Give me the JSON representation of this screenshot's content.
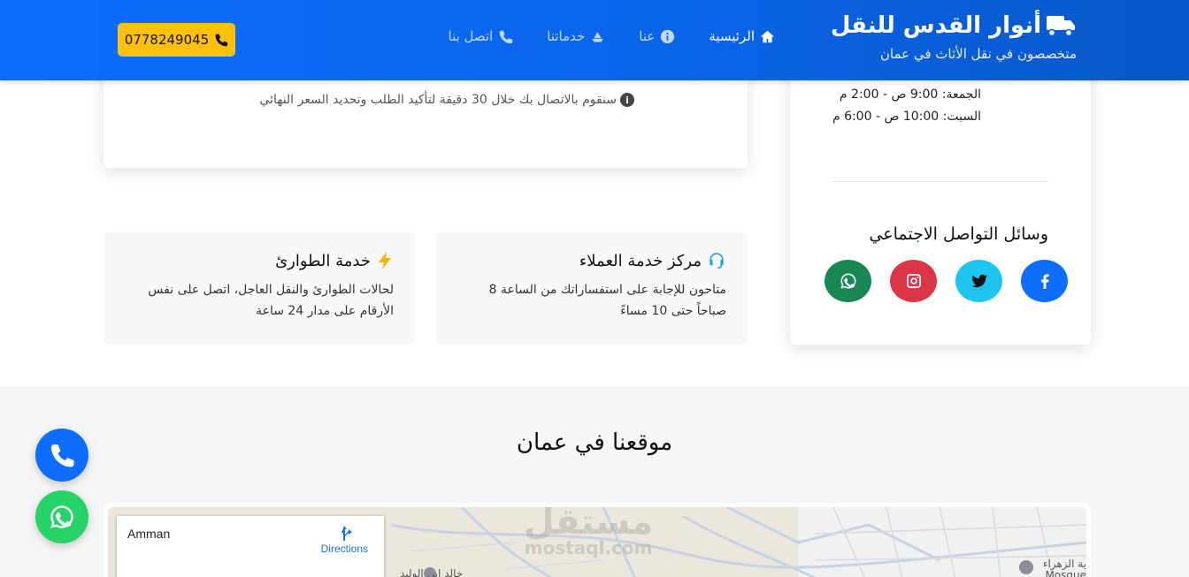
{
  "header": {
    "brand_title": "أنوار القدس للنقل",
    "brand_subtitle": "متخصصون في نقل الأثاث في عمان",
    "nav": [
      {
        "label": "الرئيسية",
        "icon": "home-icon",
        "active": true
      },
      {
        "label": "عنا",
        "icon": "info-icon",
        "active": false
      },
      {
        "label": "خدماتنا",
        "icon": "services-icon",
        "active": false
      },
      {
        "label": "اتصل بنا",
        "icon": "phone-icon",
        "active": false
      }
    ],
    "phone_button": "0778249045",
    "colors": {
      "primary": "#0d6efd",
      "accent": "#ffc107"
    }
  },
  "form_card": {
    "note": "سنقوم بالاتصال بك خلال 30 دقيقة لتأكيد الطلب وتحديد السعر النهائي"
  },
  "sidebar": {
    "hours_friday": "الجمعة: 9:00 ص - 2:00 م",
    "hours_saturday": "السبت: 10:00 ص - 6:00 م",
    "social_title": "وسائل التواصل الاجتماعي",
    "socials": [
      {
        "name": "facebook",
        "color": "#1877f2"
      },
      {
        "name": "twitter",
        "color": "#1da1f2"
      },
      {
        "name": "instagram",
        "color": "#dc3545"
      },
      {
        "name": "whatsapp",
        "color": "#198754"
      }
    ]
  },
  "features": [
    {
      "title": "مركز خدمة العملاء",
      "icon": "headset-icon",
      "text": "متاحون للإجابة على استفساراتك من الساعة 8 صباحاً حتى 10 مساءً"
    },
    {
      "title": "خدمة الطوارئ",
      "icon": "lightning-icon",
      "text": "لحالات الطوارئ والنقل العاجل، اتصل على نفس الأرقام على مدار 24 ساعة"
    }
  ],
  "location": {
    "title": "موقعنا في عمان",
    "map_place": "Amman",
    "map_directions": "Directions",
    "watermark_ar": "مستقل",
    "watermark_en": "mostaql.com",
    "map_label_right": "ية الزهراء",
    "map_label_right_en": "Mosque",
    "map_label_left": "خالد ابن الوليد"
  }
}
